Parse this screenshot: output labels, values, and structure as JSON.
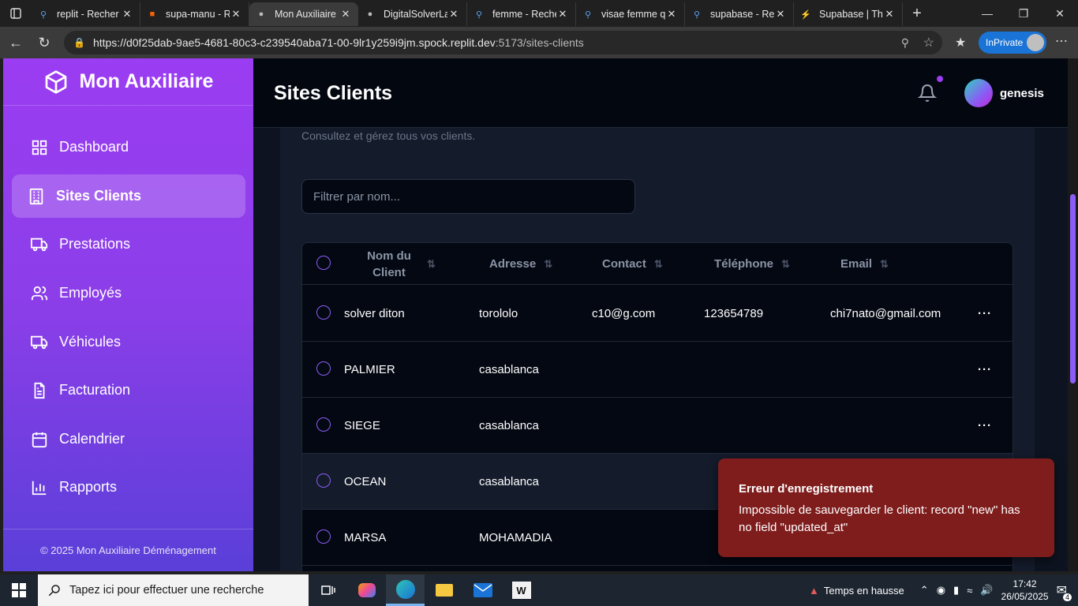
{
  "browser": {
    "tabs": [
      {
        "title": "replit - Recher",
        "favicon": "search-icon"
      },
      {
        "title": "supa-manu - R",
        "favicon": "replit-icon"
      },
      {
        "title": "Mon Auxiliaire",
        "favicon": "avatar-icon",
        "active": true
      },
      {
        "title": "DigitalSolverLa",
        "favicon": "avatar-icon"
      },
      {
        "title": "femme - Reche",
        "favicon": "search-icon"
      },
      {
        "title": "visae femme q",
        "favicon": "search-icon"
      },
      {
        "title": "supabase - Re",
        "favicon": "search-icon"
      },
      {
        "title": "Supabase | The",
        "favicon": "supabase-icon"
      }
    ],
    "url_host": "https://d0f25dab-9ae5-4681-80c3-c239540aba71-00-9lr1y259i9jm.spock.replit.dev",
    "url_path": ":5173/sites-clients",
    "inprivate_label": "InPrivate"
  },
  "sidebar": {
    "brand": "Mon Auxiliaire",
    "items": [
      {
        "label": "Dashboard",
        "icon": "dashboard-icon"
      },
      {
        "label": "Sites Clients",
        "icon": "building-icon",
        "active": true
      },
      {
        "label": "Prestations",
        "icon": "truck-icon"
      },
      {
        "label": "Employés",
        "icon": "users-icon"
      },
      {
        "label": "Véhicules",
        "icon": "truck-icon"
      },
      {
        "label": "Facturation",
        "icon": "file-icon"
      },
      {
        "label": "Calendrier",
        "icon": "calendar-icon"
      },
      {
        "label": "Rapports",
        "icon": "chart-icon"
      }
    ],
    "footer": "© 2025 Mon Auxiliaire Déménagement"
  },
  "header": {
    "title": "Sites Clients",
    "user": "genesis"
  },
  "content": {
    "subtitle": "Consultez et gérez tous vos clients.",
    "filter_placeholder": "Filtrer par nom...",
    "columns": [
      "Nom du Client",
      "Adresse",
      "Contact",
      "Téléphone",
      "Email"
    ],
    "rows": [
      {
        "nom": "solver diton",
        "adresse": "torololo",
        "contact": "c10@g.com",
        "telephone": "123654789",
        "email": "chi7nato@gmail.com"
      },
      {
        "nom": "PALMIER",
        "adresse": "casablanca",
        "contact": "",
        "telephone": "",
        "email": ""
      },
      {
        "nom": "SIEGE",
        "adresse": "casablanca",
        "contact": "",
        "telephone": "",
        "email": ""
      },
      {
        "nom": "OCEAN",
        "adresse": "casablanca",
        "contact": "",
        "telephone": "",
        "email": ""
      },
      {
        "nom": "MARSA",
        "adresse": "MOHAMADIA",
        "contact": "",
        "telephone": "",
        "email": ""
      }
    ]
  },
  "toast": {
    "title": "Erreur d'enregistrement",
    "message": "Impossible de sauvegarder le client: record \"new\" has no field \"updated_at\""
  },
  "taskbar": {
    "search_placeholder": "Tapez ici pour effectuer une recherche",
    "weather": "Temps en hausse",
    "time": "17:42",
    "date": "26/05/2025",
    "notifications": "4"
  }
}
